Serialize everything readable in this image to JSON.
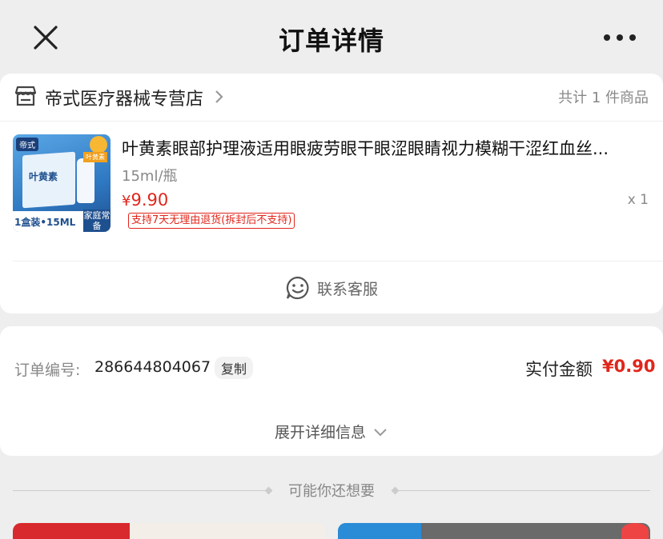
{
  "header": {
    "title": "订单详情",
    "close_icon": "close-icon",
    "more_icon": "more-dots-icon"
  },
  "shop": {
    "name": "帝式医疗器械专营店",
    "item_count": "共计 1 件商品",
    "icon": "storefront-icon"
  },
  "product": {
    "title": "叶黄素眼部护理液适用眼疲劳眼干眼涩眼睛视力模糊干涩红血丝...",
    "spec": "15ml/瓶",
    "price_symbol": "¥",
    "price": "9.90",
    "quantity": "x 1",
    "return_policy": "支持7天无理由退货(拆封后不支持)",
    "image": {
      "brand": "帝式",
      "box_text": "叶黄素",
      "tag": "叶黄素",
      "ribbon_left": "1盒装•15ML",
      "ribbon_right": "家庭常备"
    }
  },
  "customer_service": {
    "label": "联系客服",
    "icon": "smile-chat-icon"
  },
  "order": {
    "number_label": "订单编号:",
    "number": "286644804067",
    "copy_label": "复制",
    "paid_label": "实付金额",
    "paid_amount": "¥0.90",
    "expand_label": "展开详细信息",
    "expand_icon": "chevron-down-icon"
  },
  "recommend": {
    "title": "可能你还想要"
  },
  "colors": {
    "accent_red": "#e0261b",
    "background": "#eeeeee",
    "card": "#ffffff"
  }
}
